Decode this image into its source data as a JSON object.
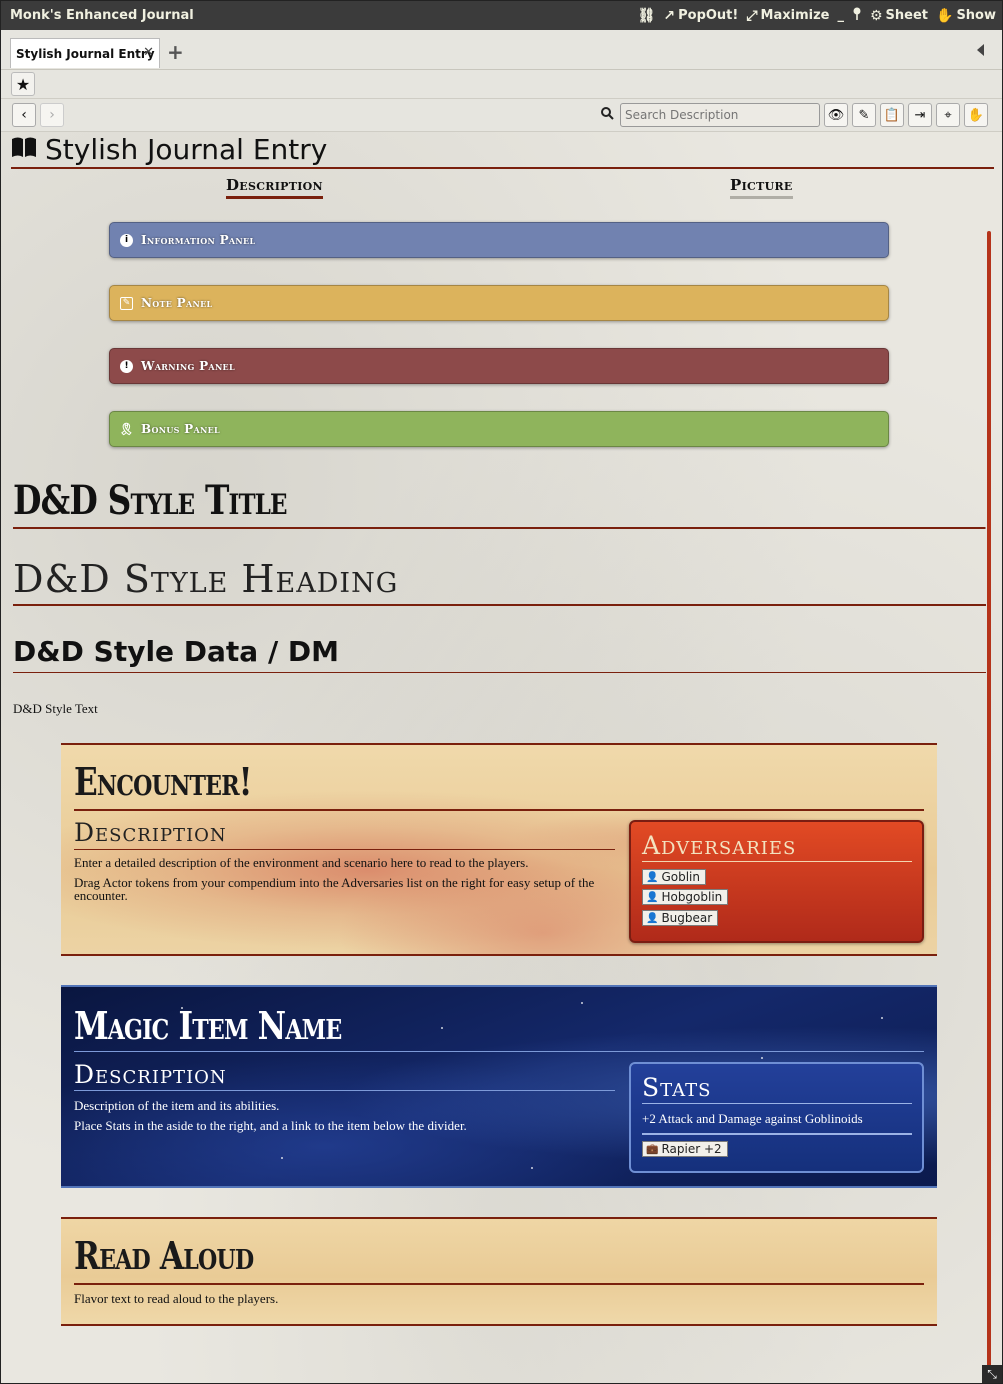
{
  "window": {
    "title": "Monk's Enhanced Journal",
    "header_buttons": [
      {
        "icon": "unlink-icon",
        "glyph": "⛓",
        "label": ""
      },
      {
        "icon": "popout-icon",
        "glyph": "↗",
        "label": "PopOut!"
      },
      {
        "icon": "maximize-icon",
        "glyph": "⤢",
        "label": "Maximize"
      },
      {
        "icon": "minimize-icon",
        "glyph": "",
        "label": "_"
      },
      {
        "icon": "pin-icon",
        "glyph": "📍",
        "label": ""
      },
      {
        "icon": "gear-icon",
        "glyph": "⚙",
        "label": "Sheet"
      },
      {
        "icon": "hand-icon",
        "glyph": "✋",
        "label": "Show"
      }
    ]
  },
  "tabs": {
    "items": [
      {
        "label": "Stylish Journal Entry",
        "close": "✕"
      }
    ],
    "add": "+"
  },
  "toolbar": {
    "search_placeholder": "Search Description",
    "buttons": [
      {
        "icon": "eye-icon",
        "glyph": "👁"
      },
      {
        "icon": "pencil-icon",
        "glyph": "✎"
      },
      {
        "icon": "clipboard-icon",
        "glyph": "📋"
      },
      {
        "icon": "export-icon",
        "glyph": "⇥"
      },
      {
        "icon": "crosshair-icon",
        "glyph": "⌖"
      },
      {
        "icon": "hand-icon",
        "glyph": "✋"
      }
    ]
  },
  "page": {
    "title": "Stylish Journal Entry",
    "subtabs": {
      "description": "Description",
      "picture": "Picture"
    }
  },
  "panels": {
    "info": "Information Panel",
    "note": "Note Panel",
    "warning": "Warning Panel",
    "bonus": "Bonus Panel"
  },
  "content": {
    "title": "D&D Style Title",
    "heading": "D&D Style Heading",
    "data_dm": "D&D Style Data / DM",
    "text": "D&D Style Text"
  },
  "encounter": {
    "title": "Encounter!",
    "description_heading": "Description",
    "paragraph1": "Enter a detailed description of the environment and scenario here to read to the players.",
    "paragraph2": "Drag Actor tokens from your compendium into the Adversaries list on the right for easy setup of the encounter.",
    "adversaries_heading": "Adversaries",
    "adversaries": [
      "Goblin",
      "Hobgoblin",
      "Bugbear"
    ]
  },
  "magic_item": {
    "title": "Magic Item Name",
    "description_heading": "Description",
    "paragraph1": "Description of the item and its abilities.",
    "paragraph2": "Place Stats in the aside to the right, and a link to the item below the divider.",
    "stats_heading": "Stats",
    "stats_text": "+2 Attack and Damage against Goblinoids",
    "item_link": "Rapier +2"
  },
  "read_aloud": {
    "title": "Read Aloud",
    "text": "Flavor text to read aloud to the players."
  },
  "colors": {
    "accent": "#7a200d",
    "info": "#7182b0",
    "note": "#dcb35c",
    "warning": "#8d4a4a",
    "bonus": "#8fb45c"
  }
}
